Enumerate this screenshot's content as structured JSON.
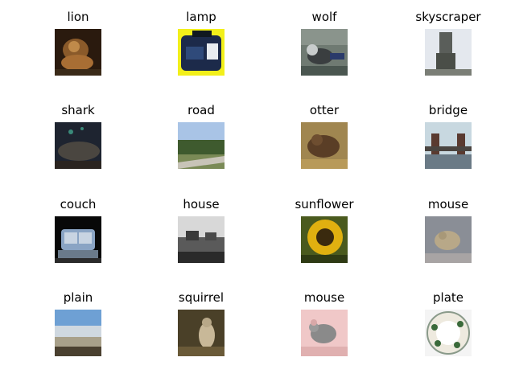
{
  "grid": {
    "cells": [
      {
        "label": "lion",
        "thumbnail": "lion-photo"
      },
      {
        "label": "lamp",
        "thumbnail": "lamp-photo"
      },
      {
        "label": "wolf",
        "thumbnail": "wolf-photo"
      },
      {
        "label": "skyscraper",
        "thumbnail": "skyscraper-photo"
      },
      {
        "label": "shark",
        "thumbnail": "shark-photo"
      },
      {
        "label": "road",
        "thumbnail": "road-photo"
      },
      {
        "label": "otter",
        "thumbnail": "otter-photo"
      },
      {
        "label": "bridge",
        "thumbnail": "bridge-photo"
      },
      {
        "label": "couch",
        "thumbnail": "couch-photo"
      },
      {
        "label": "house",
        "thumbnail": "house-photo"
      },
      {
        "label": "sunflower",
        "thumbnail": "sunflower-photo"
      },
      {
        "label": "mouse",
        "thumbnail": "mouse-photo"
      },
      {
        "label": "plain",
        "thumbnail": "plain-photo"
      },
      {
        "label": "squirrel",
        "thumbnail": "squirrel-photo"
      },
      {
        "label": "mouse",
        "thumbnail": "mouse-photo"
      },
      {
        "label": "plate",
        "thumbnail": "plate-photo"
      }
    ]
  }
}
